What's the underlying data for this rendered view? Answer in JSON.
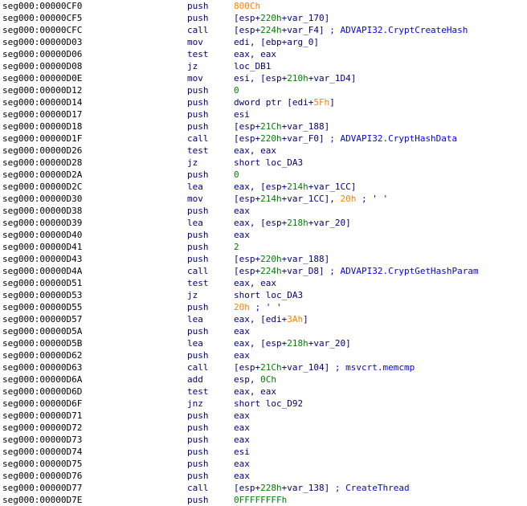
{
  "listing": {
    "lines": [
      {
        "addr": "seg000:00000CF0",
        "mnem": "push",
        "ops": [
          {
            "t": "800Ch",
            "k": "imm"
          }
        ]
      },
      {
        "addr": "seg000:00000CF5",
        "mnem": "push",
        "ops": [
          {
            "t": "[esp+",
            "k": "txt"
          },
          {
            "t": "220h",
            "k": "num"
          },
          {
            "t": "+var_170]",
            "k": "txt"
          }
        ]
      },
      {
        "addr": "seg000:00000CFC",
        "mnem": "call",
        "ops": [
          {
            "t": "[esp+",
            "k": "txt"
          },
          {
            "t": "224h",
            "k": "num"
          },
          {
            "t": "+var_F4]",
            "k": "txt"
          },
          {
            "t": " ; ADVAPI32.CryptCreateHash",
            "k": "cmt"
          }
        ]
      },
      {
        "addr": "seg000:00000D03",
        "mnem": "mov",
        "ops": [
          {
            "t": "edi, [ebp+arg_0]",
            "k": "txt"
          }
        ]
      },
      {
        "addr": "seg000:00000D06",
        "mnem": "test",
        "ops": [
          {
            "t": "eax, eax",
            "k": "txt"
          }
        ]
      },
      {
        "addr": "seg000:00000D08",
        "mnem": "jz",
        "ops": [
          {
            "t": "loc_DB1",
            "k": "txt"
          }
        ]
      },
      {
        "addr": "seg000:00000D0E",
        "mnem": "mov",
        "ops": [
          {
            "t": "esi, [esp+",
            "k": "txt"
          },
          {
            "t": "210h",
            "k": "num"
          },
          {
            "t": "+var_1D4]",
            "k": "txt"
          }
        ]
      },
      {
        "addr": "seg000:00000D12",
        "mnem": "push",
        "ops": [
          {
            "t": "0",
            "k": "num"
          }
        ]
      },
      {
        "addr": "seg000:00000D14",
        "mnem": "push",
        "ops": [
          {
            "t": "dword ptr [edi+",
            "k": "txt"
          },
          {
            "t": "5Fh",
            "k": "imm"
          },
          {
            "t": "]",
            "k": "txt"
          }
        ]
      },
      {
        "addr": "seg000:00000D17",
        "mnem": "push",
        "ops": [
          {
            "t": "esi",
            "k": "txt"
          }
        ]
      },
      {
        "addr": "seg000:00000D18",
        "mnem": "push",
        "ops": [
          {
            "t": "[esp+",
            "k": "txt"
          },
          {
            "t": "21Ch",
            "k": "num"
          },
          {
            "t": "+var_188]",
            "k": "txt"
          }
        ]
      },
      {
        "addr": "seg000:00000D1F",
        "mnem": "call",
        "ops": [
          {
            "t": "[esp+",
            "k": "txt"
          },
          {
            "t": "220h",
            "k": "num"
          },
          {
            "t": "+var_F0]",
            "k": "txt"
          },
          {
            "t": " ; ADVAPI32.CryptHashData",
            "k": "cmt"
          }
        ]
      },
      {
        "addr": "seg000:00000D26",
        "mnem": "test",
        "ops": [
          {
            "t": "eax, eax",
            "k": "txt"
          }
        ]
      },
      {
        "addr": "seg000:00000D28",
        "mnem": "jz",
        "ops": [
          {
            "t": "short loc_DA3",
            "k": "txt"
          }
        ]
      },
      {
        "addr": "seg000:00000D2A",
        "mnem": "push",
        "ops": [
          {
            "t": "0",
            "k": "num"
          }
        ]
      },
      {
        "addr": "seg000:00000D2C",
        "mnem": "lea",
        "ops": [
          {
            "t": "eax, [esp+",
            "k": "txt"
          },
          {
            "t": "214h",
            "k": "num"
          },
          {
            "t": "+var_1CC]",
            "k": "txt"
          }
        ]
      },
      {
        "addr": "seg000:00000D30",
        "mnem": "mov",
        "ops": [
          {
            "t": "[esp+",
            "k": "txt"
          },
          {
            "t": "214h",
            "k": "num"
          },
          {
            "t": "+var_1CC], ",
            "k": "txt"
          },
          {
            "t": "20h",
            "k": "imm"
          },
          {
            "t": " ; ' '",
            "k": "cmt"
          }
        ]
      },
      {
        "addr": "seg000:00000D38",
        "mnem": "push",
        "ops": [
          {
            "t": "eax",
            "k": "txt"
          }
        ]
      },
      {
        "addr": "seg000:00000D39",
        "mnem": "lea",
        "ops": [
          {
            "t": "eax, [esp+",
            "k": "txt"
          },
          {
            "t": "218h",
            "k": "num"
          },
          {
            "t": "+var_20]",
            "k": "txt"
          }
        ]
      },
      {
        "addr": "seg000:00000D40",
        "mnem": "push",
        "ops": [
          {
            "t": "eax",
            "k": "txt"
          }
        ]
      },
      {
        "addr": "seg000:00000D41",
        "mnem": "push",
        "ops": [
          {
            "t": "2",
            "k": "num"
          }
        ]
      },
      {
        "addr": "seg000:00000D43",
        "mnem": "push",
        "ops": [
          {
            "t": "[esp+",
            "k": "txt"
          },
          {
            "t": "220h",
            "k": "num"
          },
          {
            "t": "+var_188]",
            "k": "txt"
          }
        ]
      },
      {
        "addr": "seg000:00000D4A",
        "mnem": "call",
        "ops": [
          {
            "t": "[esp+",
            "k": "txt"
          },
          {
            "t": "224h",
            "k": "num"
          },
          {
            "t": "+var_D8]",
            "k": "txt"
          },
          {
            "t": " ; ADVAPI32.CryptGetHashParam",
            "k": "cmt"
          }
        ]
      },
      {
        "addr": "seg000:00000D51",
        "mnem": "test",
        "ops": [
          {
            "t": "eax, eax",
            "k": "txt"
          }
        ]
      },
      {
        "addr": "seg000:00000D53",
        "mnem": "jz",
        "ops": [
          {
            "t": "short loc_DA3",
            "k": "txt"
          }
        ]
      },
      {
        "addr": "seg000:00000D55",
        "mnem": "push",
        "ops": [
          {
            "t": "20h",
            "k": "imm"
          },
          {
            "t": " ; ' '",
            "k": "cmt"
          }
        ]
      },
      {
        "addr": "seg000:00000D57",
        "mnem": "lea",
        "ops": [
          {
            "t": "eax, [edi+",
            "k": "txt"
          },
          {
            "t": "3Ah",
            "k": "imm"
          },
          {
            "t": "]",
            "k": "txt"
          }
        ]
      },
      {
        "addr": "seg000:00000D5A",
        "mnem": "push",
        "ops": [
          {
            "t": "eax",
            "k": "txt"
          }
        ]
      },
      {
        "addr": "seg000:00000D5B",
        "mnem": "lea",
        "ops": [
          {
            "t": "eax, [esp+",
            "k": "txt"
          },
          {
            "t": "218h",
            "k": "num"
          },
          {
            "t": "+var_20]",
            "k": "txt"
          }
        ]
      },
      {
        "addr": "seg000:00000D62",
        "mnem": "push",
        "ops": [
          {
            "t": "eax",
            "k": "txt"
          }
        ]
      },
      {
        "addr": "seg000:00000D63",
        "mnem": "call",
        "ops": [
          {
            "t": "[esp+",
            "k": "txt"
          },
          {
            "t": "21Ch",
            "k": "num"
          },
          {
            "t": "+var_104]",
            "k": "txt"
          },
          {
            "t": " ; msvcrt.memcmp",
            "k": "cmt"
          }
        ]
      },
      {
        "addr": "seg000:00000D6A",
        "mnem": "add",
        "ops": [
          {
            "t": "esp, ",
            "k": "txt"
          },
          {
            "t": "0Ch",
            "k": "num"
          }
        ]
      },
      {
        "addr": "seg000:00000D6D",
        "mnem": "test",
        "ops": [
          {
            "t": "eax, eax",
            "k": "txt"
          }
        ]
      },
      {
        "addr": "seg000:00000D6F",
        "mnem": "jnz",
        "ops": [
          {
            "t": "short loc_D92",
            "k": "txt"
          }
        ]
      },
      {
        "addr": "seg000:00000D71",
        "mnem": "push",
        "ops": [
          {
            "t": "eax",
            "k": "txt"
          }
        ]
      },
      {
        "addr": "seg000:00000D72",
        "mnem": "push",
        "ops": [
          {
            "t": "eax",
            "k": "txt"
          }
        ]
      },
      {
        "addr": "seg000:00000D73",
        "mnem": "push",
        "ops": [
          {
            "t": "eax",
            "k": "txt"
          }
        ]
      },
      {
        "addr": "seg000:00000D74",
        "mnem": "push",
        "ops": [
          {
            "t": "esi",
            "k": "txt"
          }
        ]
      },
      {
        "addr": "seg000:00000D75",
        "mnem": "push",
        "ops": [
          {
            "t": "eax",
            "k": "txt"
          }
        ]
      },
      {
        "addr": "seg000:00000D76",
        "mnem": "push",
        "ops": [
          {
            "t": "eax",
            "k": "txt"
          }
        ]
      },
      {
        "addr": "seg000:00000D77",
        "mnem": "call",
        "ops": [
          {
            "t": "[esp+",
            "k": "txt"
          },
          {
            "t": "228h",
            "k": "num"
          },
          {
            "t": "+var_138]",
            "k": "txt"
          },
          {
            "t": " ; CreateThread",
            "k": "cmt"
          }
        ]
      },
      {
        "addr": "seg000:00000D7E",
        "mnem": "push",
        "ops": [
          {
            "t": "0FFFFFFFFh",
            "k": "num"
          }
        ]
      }
    ]
  },
  "colors": {
    "background": "#ffffff",
    "address": "#000000",
    "mnemonic": "#000080",
    "operand": "#000080",
    "number": "#008000",
    "immediate": "#ff8000",
    "comment": "#0000ff"
  }
}
